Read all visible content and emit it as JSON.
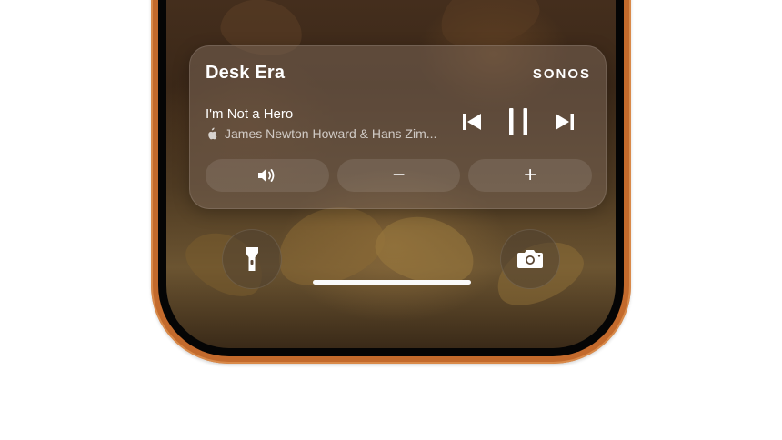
{
  "now_playing": {
    "room": "Desk Era",
    "brand": "SONOS",
    "track_title": "I'm Not a Hero",
    "artist": "James Newton Howard & Hans Zim...",
    "source_icon": "apple-icon"
  },
  "controls": {
    "previous_icon": "previous-track-icon",
    "pause_icon": "pause-icon",
    "next_icon": "next-track-icon",
    "volume_icon": "speaker-volume-icon",
    "volume_down_label": "−",
    "volume_up_label": "+"
  },
  "lock_screen": {
    "left_shortcut_icon": "flashlight-icon",
    "right_shortcut_icon": "camera-icon"
  },
  "colors": {
    "phone_frame": "#c36a2c",
    "widget_bg": "rgba(120,100,85,0.55)"
  }
}
